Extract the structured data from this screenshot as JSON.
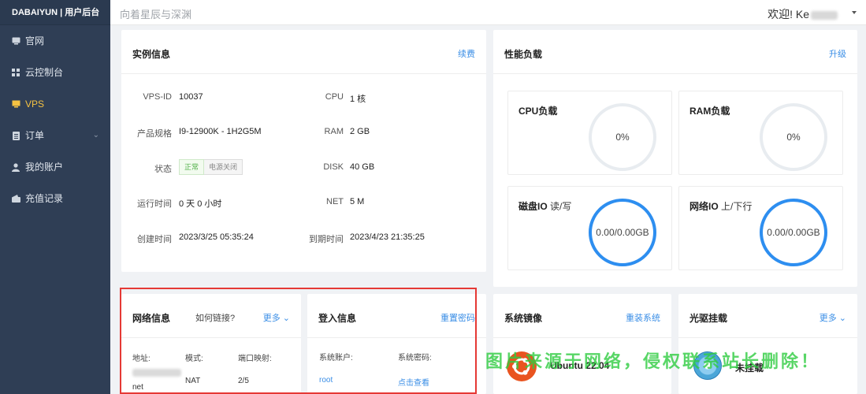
{
  "sidebar": {
    "brand": "DABAIYUN | 用户后台",
    "items": [
      {
        "label": "官网",
        "icon": "monitor-icon"
      },
      {
        "label": "云控制台",
        "icon": "grid-icon"
      },
      {
        "label": "VPS",
        "icon": "screen-icon",
        "active": true
      },
      {
        "label": "订单",
        "icon": "list-icon",
        "has_arrow": true
      },
      {
        "label": "我的账户",
        "icon": "user-icon"
      },
      {
        "label": "充值记录",
        "icon": "wallet-icon"
      }
    ]
  },
  "topbar": {
    "slogan": "向着星辰与深渊",
    "welcome": "欢迎! Ke"
  },
  "instance": {
    "title": "实例信息",
    "action": "续费",
    "rows": [
      {
        "l1": "VPS-ID",
        "v1": "10037",
        "l2": "CPU",
        "v2": "1 核"
      },
      {
        "l1": "产品规格",
        "v1": "I9-12900K - 1H2G5M",
        "l2": "RAM",
        "v2": "2 GB"
      },
      {
        "l1": "状态",
        "v1": "",
        "l2": "DISK",
        "v2": "40 GB"
      },
      {
        "l1": "运行时间",
        "v1": "0 天 0 小时",
        "l2": "NET",
        "v2": "5 M"
      },
      {
        "l1": "创建时间",
        "v1": "2023/3/25 05:35:24",
        "l2": "到期时间",
        "v2": "2023/4/23 21:35:25"
      }
    ],
    "status_tag": "正常",
    "power_tag": "电源关闭"
  },
  "perf": {
    "title": "性能负载",
    "action": "升级",
    "gauges": [
      {
        "title": "CPU负载",
        "sub": "",
        "value": "0%",
        "level": 0,
        "color": "#e8ecf0"
      },
      {
        "title": "RAM负载",
        "sub": "",
        "value": "0%",
        "level": 0,
        "color": "#e8ecf0"
      },
      {
        "title": "磁盘IO",
        "sub": "读/写",
        "value": "0.00/0.00GB",
        "level": 1,
        "color": "#2d8ef0"
      },
      {
        "title": "网络IO",
        "sub": "上/下行",
        "value": "0.00/0.00GB",
        "level": 1,
        "color": "#2d8ef0"
      }
    ]
  },
  "network": {
    "title": "网络信息",
    "how": "如何链接?",
    "more": "更多",
    "cols": [
      "地址:",
      "模式:",
      "端口映射:"
    ],
    "addr_suffix": "net",
    "mode": "NAT",
    "ports": "2/5"
  },
  "login": {
    "title": "登入信息",
    "action": "重置密码",
    "cols": [
      "系统账户:",
      "系统密码:"
    ],
    "account": "root",
    "password_link": "点击查看"
  },
  "image": {
    "title": "系统镜像",
    "action": "重装系统",
    "os": "Ubuntu 22.04"
  },
  "cdrom": {
    "title": "光驱挂载",
    "more": "更多",
    "state": "未挂载"
  },
  "watermark": "图片来源于网络，侵权联系站长删除！"
}
